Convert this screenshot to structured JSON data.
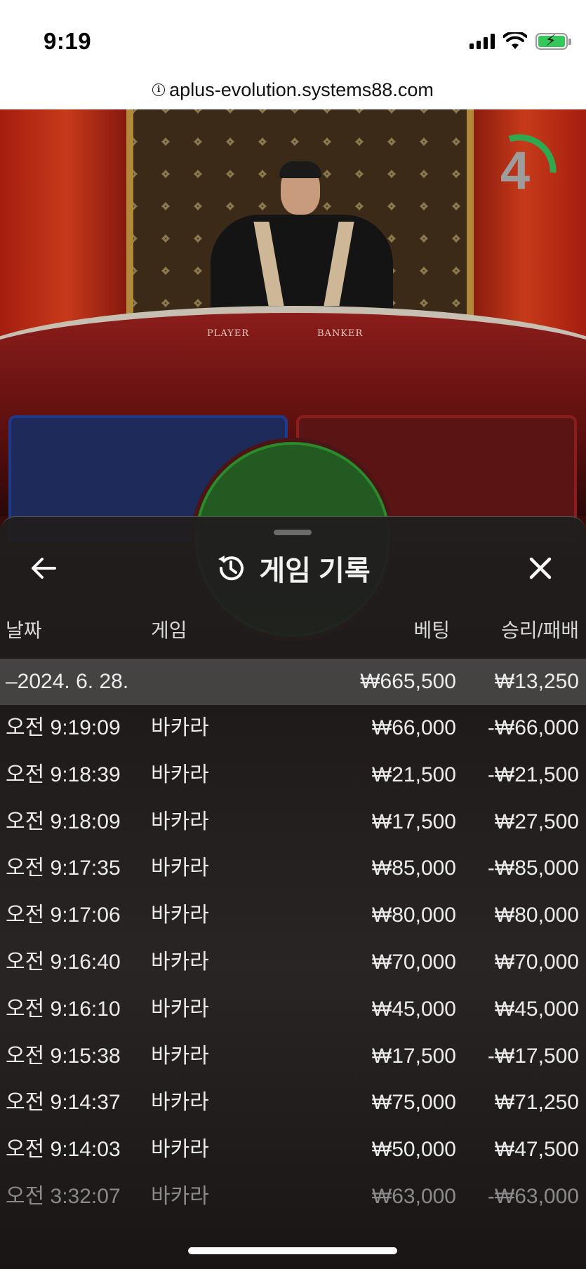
{
  "status_bar": {
    "time": "9:19",
    "signal_icon": "cellular-signal-icon",
    "wifi_icon": "wifi-icon",
    "battery_icon": "battery-charging-icon",
    "battery_color": "#34c759"
  },
  "browser": {
    "url": "aplus-evolution.systems88.com",
    "info_icon": "info-icon"
  },
  "live_table": {
    "countdown": "4",
    "countdown_color": "#2fa84f",
    "table_labels": {
      "player": "PLAYER",
      "banker": "BANKER"
    }
  },
  "panel": {
    "title": "게임 기록",
    "back_icon": "arrow-left-icon",
    "history_icon": "history-icon",
    "close_icon": "close-icon",
    "columns": {
      "date": "날짜",
      "game": "게임",
      "bet": "베팅",
      "win_loss": "승리/패배"
    },
    "summary": {
      "date": "–2024. 6. 28.",
      "bet": "₩665,500",
      "win_loss": "₩13,250"
    },
    "rows": [
      {
        "time": "오전 9:19:09",
        "game": "바카라",
        "bet": "₩66,000",
        "win_loss": "-₩66,000"
      },
      {
        "time": "오전 9:18:39",
        "game": "바카라",
        "bet": "₩21,500",
        "win_loss": "-₩21,500"
      },
      {
        "time": "오전 9:18:09",
        "game": "바카라",
        "bet": "₩17,500",
        "win_loss": "₩27,500"
      },
      {
        "time": "오전 9:17:35",
        "game": "바카라",
        "bet": "₩85,000",
        "win_loss": "-₩85,000"
      },
      {
        "time": "오전 9:17:06",
        "game": "바카라",
        "bet": "₩80,000",
        "win_loss": "₩80,000"
      },
      {
        "time": "오전 9:16:40",
        "game": "바카라",
        "bet": "₩70,000",
        "win_loss": "₩70,000"
      },
      {
        "time": "오전 9:16:10",
        "game": "바카라",
        "bet": "₩45,000",
        "win_loss": "₩45,000"
      },
      {
        "time": "오전 9:15:38",
        "game": "바카라",
        "bet": "₩17,500",
        "win_loss": "-₩17,500"
      },
      {
        "time": "오전 9:14:37",
        "game": "바카라",
        "bet": "₩75,000",
        "win_loss": "₩71,250"
      },
      {
        "time": "오전 9:14:03",
        "game": "바카라",
        "bet": "₩50,000",
        "win_loss": "₩47,500"
      },
      {
        "time": "오전 3:32:07",
        "game": "바카라",
        "bet": "₩63,000",
        "win_loss": "-₩63,000"
      }
    ]
  }
}
